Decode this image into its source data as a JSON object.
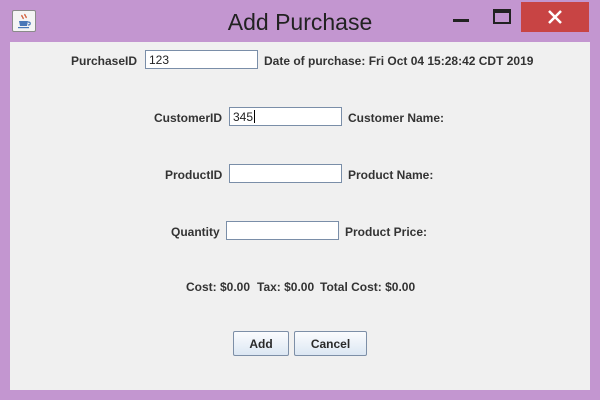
{
  "window": {
    "title": "Add Purchase",
    "app_icon": "java-coffee-cup-icon",
    "controls": [
      "minimize-icon",
      "maximize-icon",
      "close-icon"
    ],
    "frame_color": "#c396d0",
    "close_color": "#c84444"
  },
  "form": {
    "purchase_id": {
      "label": "PurchaseID",
      "value": "123"
    },
    "date_of_purchase": "Date of purchase: Fri Oct 04 15:28:42 CDT 2019",
    "customer_id": {
      "label": "CustomerID",
      "value": "345"
    },
    "customer_name_label": "Customer Name:",
    "product_id": {
      "label": "ProductID",
      "value": ""
    },
    "product_name_label": "Product Name:",
    "quantity": {
      "label": "Quantity",
      "value": ""
    },
    "product_price_label": "Product Price:",
    "cost_label": "Cost: $0.00",
    "tax_label": "Tax: $0.00",
    "total_cost_label": "Total Cost: $0.00"
  },
  "buttons": {
    "add_label": "Add",
    "cancel_label": "Cancel"
  }
}
